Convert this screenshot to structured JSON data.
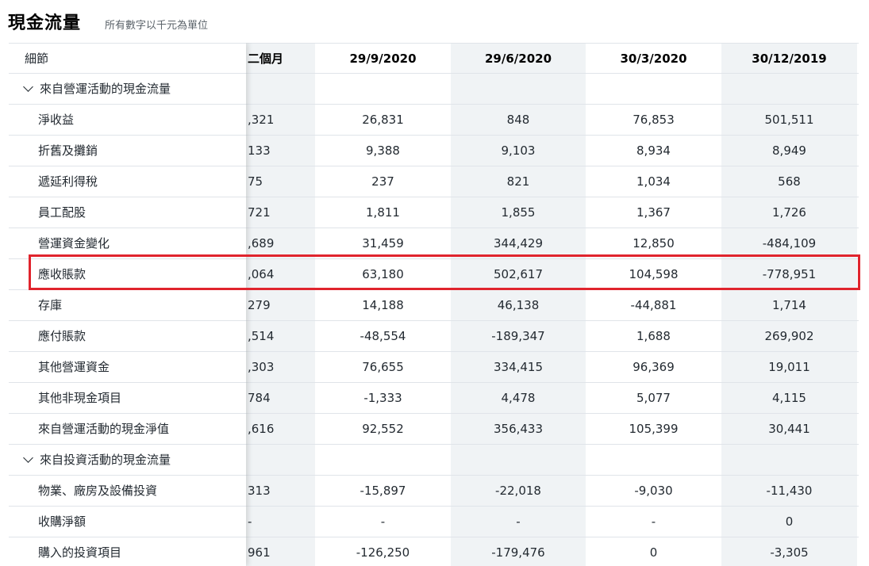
{
  "header": {
    "title": "現金流量",
    "subtitle": "所有數字以千元為單位"
  },
  "table": {
    "label_header": "細節",
    "columns": [
      "二個月",
      "29/9/2020",
      "29/6/2020",
      "30/3/2020",
      "30/12/2019"
    ],
    "rows": [
      {
        "type": "section",
        "label": "來自營運活動的現金流量",
        "values": [
          "",
          "",
          "",
          "",
          ""
        ]
      },
      {
        "type": "item",
        "label": "淨收益",
        "values": [
          ",321",
          "26,831",
          "848",
          "76,853",
          "501,511"
        ]
      },
      {
        "type": "item",
        "label": "折舊及攤銷",
        "values": [
          "133",
          "9,388",
          "9,103",
          "8,934",
          "8,949"
        ]
      },
      {
        "type": "item",
        "label": "遞延利得稅",
        "values": [
          "75",
          "237",
          "821",
          "1,034",
          "568"
        ]
      },
      {
        "type": "item",
        "label": "員工配股",
        "values": [
          "721",
          "1,811",
          "1,855",
          "1,367",
          "1,726"
        ]
      },
      {
        "type": "item",
        "label": "營運資金變化",
        "values": [
          ",689",
          "31,459",
          "344,429",
          "12,850",
          "-484,109"
        ]
      },
      {
        "type": "item",
        "label": "應收賬款",
        "values": [
          ",064",
          "63,180",
          "502,617",
          "104,598",
          "-778,951"
        ],
        "highlighted": true
      },
      {
        "type": "item",
        "label": "存庫",
        "values": [
          "279",
          "14,188",
          "46,138",
          "-44,881",
          "1,714"
        ]
      },
      {
        "type": "item",
        "label": "應付賬款",
        "values": [
          ",514",
          "-48,554",
          "-189,347",
          "1,688",
          "269,902"
        ]
      },
      {
        "type": "item",
        "label": "其他營運資金",
        "values": [
          ",303",
          "76,655",
          "334,415",
          "96,369",
          "19,011"
        ]
      },
      {
        "type": "item",
        "label": "其他非現金項目",
        "values": [
          "784",
          "-1,333",
          "4,478",
          "5,077",
          "4,115"
        ]
      },
      {
        "type": "item",
        "label": "來自營運活動的現金淨值",
        "values": [
          ",616",
          "92,552",
          "356,433",
          "105,399",
          "30,441"
        ],
        "bold": true
      },
      {
        "type": "section",
        "label": "來自投資活動的現金流量",
        "values": [
          "",
          "",
          "",
          "",
          ""
        ]
      },
      {
        "type": "item",
        "label": "物業、廠房及設備投資",
        "values": [
          "313",
          "-15,897",
          "-22,018",
          "-9,030",
          "-11,430"
        ]
      },
      {
        "type": "item",
        "label": "收購淨額",
        "values": [
          "-",
          "-",
          "-",
          "-",
          "0"
        ]
      },
      {
        "type": "item",
        "label": "購入的投資項目",
        "values": [
          "961",
          "-126,250",
          "-179,476",
          "0",
          "-3,305"
        ]
      }
    ]
  },
  "colors": {
    "shaded_column": "#f0f3f5",
    "highlight": "#e0242d",
    "divider": "#e0e4e9"
  },
  "icons": {
    "section_toggle": "chevron-down-icon"
  }
}
